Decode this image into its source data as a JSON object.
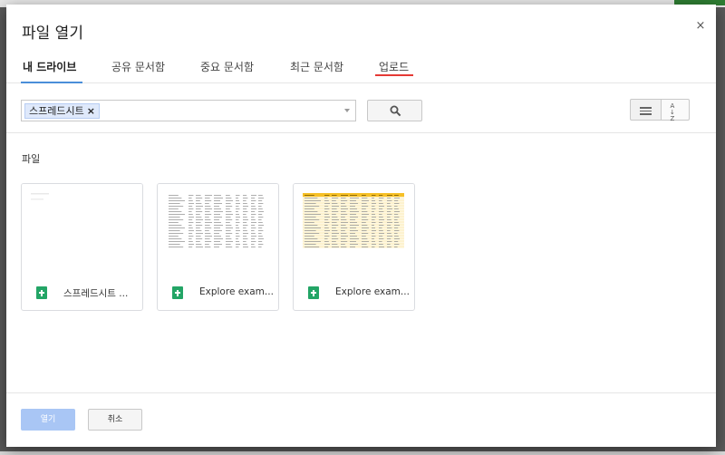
{
  "dialog": {
    "title": "파일 열기",
    "close_glyph": "×"
  },
  "tabs": [
    {
      "label": "내 드라이브",
      "active": true
    },
    {
      "label": "공유 문서함",
      "active": false
    },
    {
      "label": "중요 문서함",
      "active": false
    },
    {
      "label": "최근 문서함",
      "active": false
    },
    {
      "label": "업로드",
      "active": false
    }
  ],
  "search": {
    "chip_label": "스프레드시트",
    "chip_remove_glyph": "×"
  },
  "section": {
    "label": "파일"
  },
  "files": [
    {
      "name": "스프레드시트 ...",
      "icon": "sheets-icon"
    },
    {
      "name": "Explore exam...",
      "icon": "sheets-icon"
    },
    {
      "name": "Explore exam...",
      "icon": "sheets-icon"
    }
  ],
  "sort_button": {
    "top": "A",
    "bottom": "Z"
  },
  "footer": {
    "open_label": "열기",
    "cancel_label": "취소"
  },
  "colors": {
    "active_tab_underline": "#4a8ed9",
    "upload_tab_underline": "#e53935",
    "open_button": "#a9c6f5",
    "sheets_green": "#23a566",
    "thumb_header_yellow": "#f6c026"
  }
}
